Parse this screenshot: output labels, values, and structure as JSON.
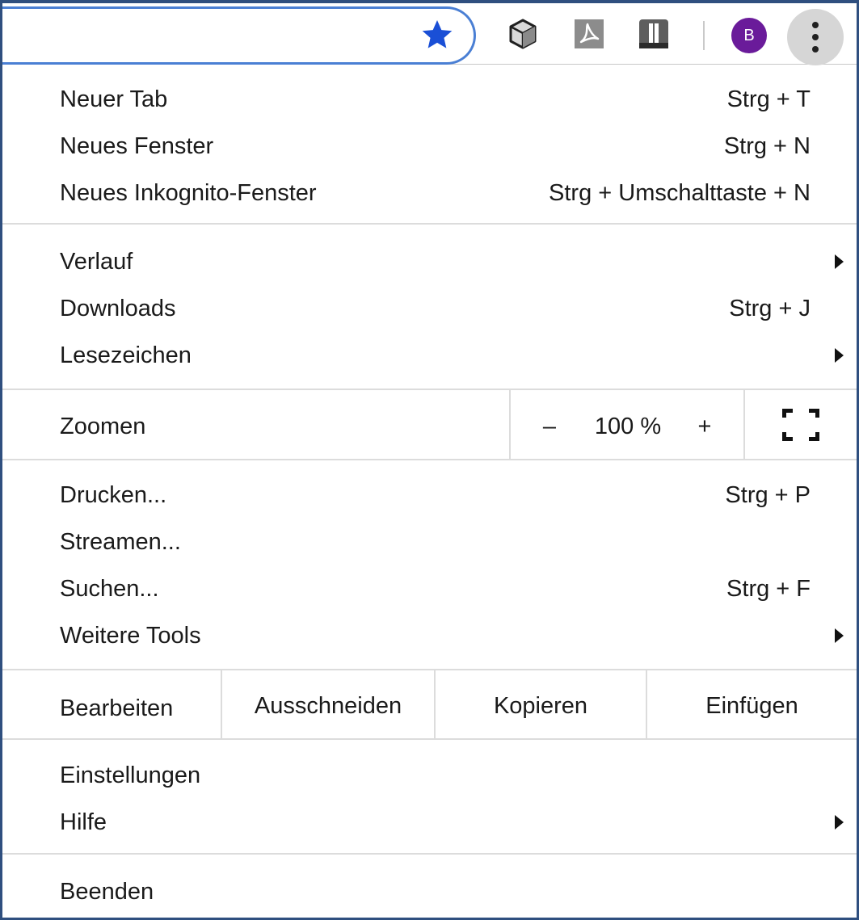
{
  "toolbar": {
    "avatar_initial": "B",
    "icons": [
      "star-icon",
      "cube-icon",
      "pdf-icon",
      "extension-icon",
      "more-vert-icon"
    ],
    "accent_color": "#1a4fd6",
    "avatar_color": "#6a1b9a"
  },
  "menu": {
    "new_tab": {
      "label": "Neuer Tab",
      "shortcut": "Strg + T"
    },
    "new_window": {
      "label": "Neues Fenster",
      "shortcut": "Strg + N"
    },
    "incognito": {
      "label": "Neues Inkognito-Fenster",
      "shortcut": "Strg + Umschalttaste + N"
    },
    "history": {
      "label": "Verlauf"
    },
    "downloads": {
      "label": "Downloads",
      "shortcut": "Strg + J"
    },
    "bookmarks": {
      "label": "Lesezeichen"
    },
    "zoom": {
      "label": "Zoomen",
      "minus": "–",
      "value": "100 %",
      "plus": "+"
    },
    "print": {
      "label": "Drucken...",
      "shortcut": "Strg + P"
    },
    "cast": {
      "label": "Streamen..."
    },
    "find": {
      "label": "Suchen...",
      "shortcut": "Strg + F"
    },
    "more_tools": {
      "label": "Weitere Tools"
    },
    "edit": {
      "label": "Bearbeiten",
      "cut": "Ausschneiden",
      "copy": "Kopieren",
      "paste": "Einfügen"
    },
    "settings": {
      "label": "Einstellungen"
    },
    "help": {
      "label": "Hilfe"
    },
    "exit": {
      "label": "Beenden"
    }
  }
}
